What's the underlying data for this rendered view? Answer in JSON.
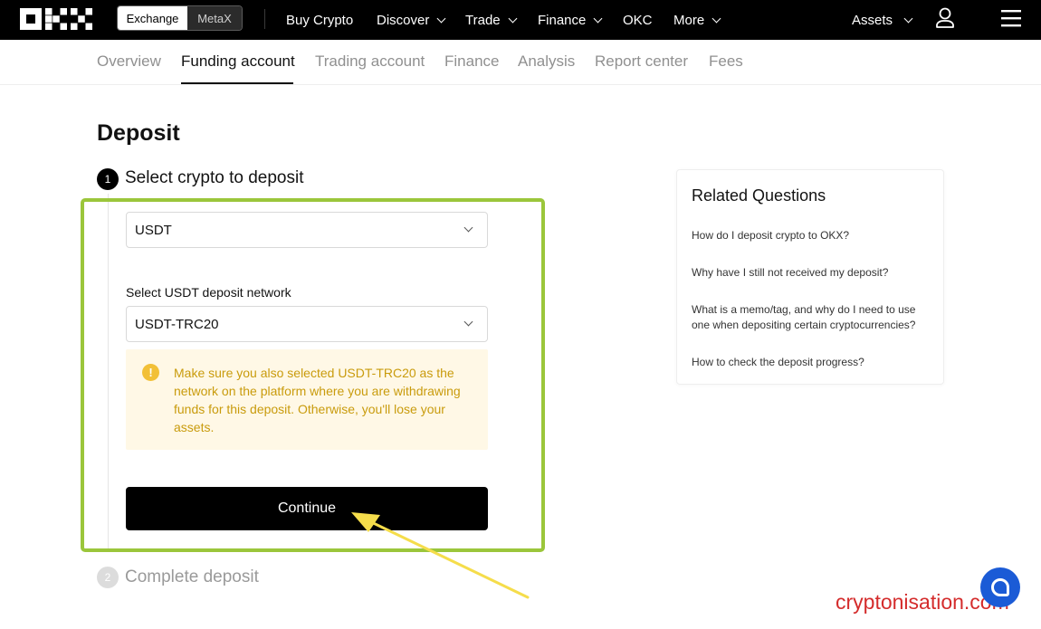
{
  "header": {
    "mode_switch": [
      "Exchange",
      "MetaX"
    ],
    "nav": [
      {
        "label": "Buy Crypto",
        "dropdown": false
      },
      {
        "label": "Discover",
        "dropdown": true
      },
      {
        "label": "Trade",
        "dropdown": true
      },
      {
        "label": "Finance",
        "dropdown": true
      },
      {
        "label": "OKC",
        "dropdown": false
      },
      {
        "label": "More",
        "dropdown": true
      }
    ],
    "assets_label": "Assets",
    "icons": [
      "okx-logo",
      "user-icon",
      "menu-icon"
    ]
  },
  "subnav": {
    "tabs": [
      "Overview",
      "Funding account",
      "Trading account",
      "Finance",
      "Analysis",
      "Report center",
      "Fees"
    ],
    "active": "Funding account"
  },
  "main": {
    "title": "Deposit",
    "step1": {
      "number": "1",
      "title": "Select crypto to deposit"
    },
    "crypto_select": {
      "value": "USDT"
    },
    "network_label": "Select USDT deposit network",
    "network_select": {
      "value": "USDT-TRC20"
    },
    "warning": {
      "icon": "!",
      "text": "Make sure you also selected USDT-TRC20 as the network on the platform where you are withdrawing funds for this deposit. Otherwise, you'll lose your assets."
    },
    "continue_label": "Continue",
    "step2": {
      "number": "2",
      "title": "Complete deposit"
    }
  },
  "related": {
    "title": "Related Questions",
    "questions": [
      "How do I deposit crypto to OKX?",
      "Why have I still not received my deposit?",
      "What is a memo/tag, and why do I need to use one when depositing certain cryptocurrencies?",
      "How to check the deposit progress?"
    ]
  },
  "overlay": {
    "watermark": "cryptonisation.com",
    "highlight_color": "#9bc63b",
    "arrow_color": "#f5dd4b"
  },
  "colors": {
    "brand": "#000000",
    "warning_bg": "#fff8e6",
    "warning_text": "#c99b0c",
    "chat_button": "#1b5bd6"
  }
}
